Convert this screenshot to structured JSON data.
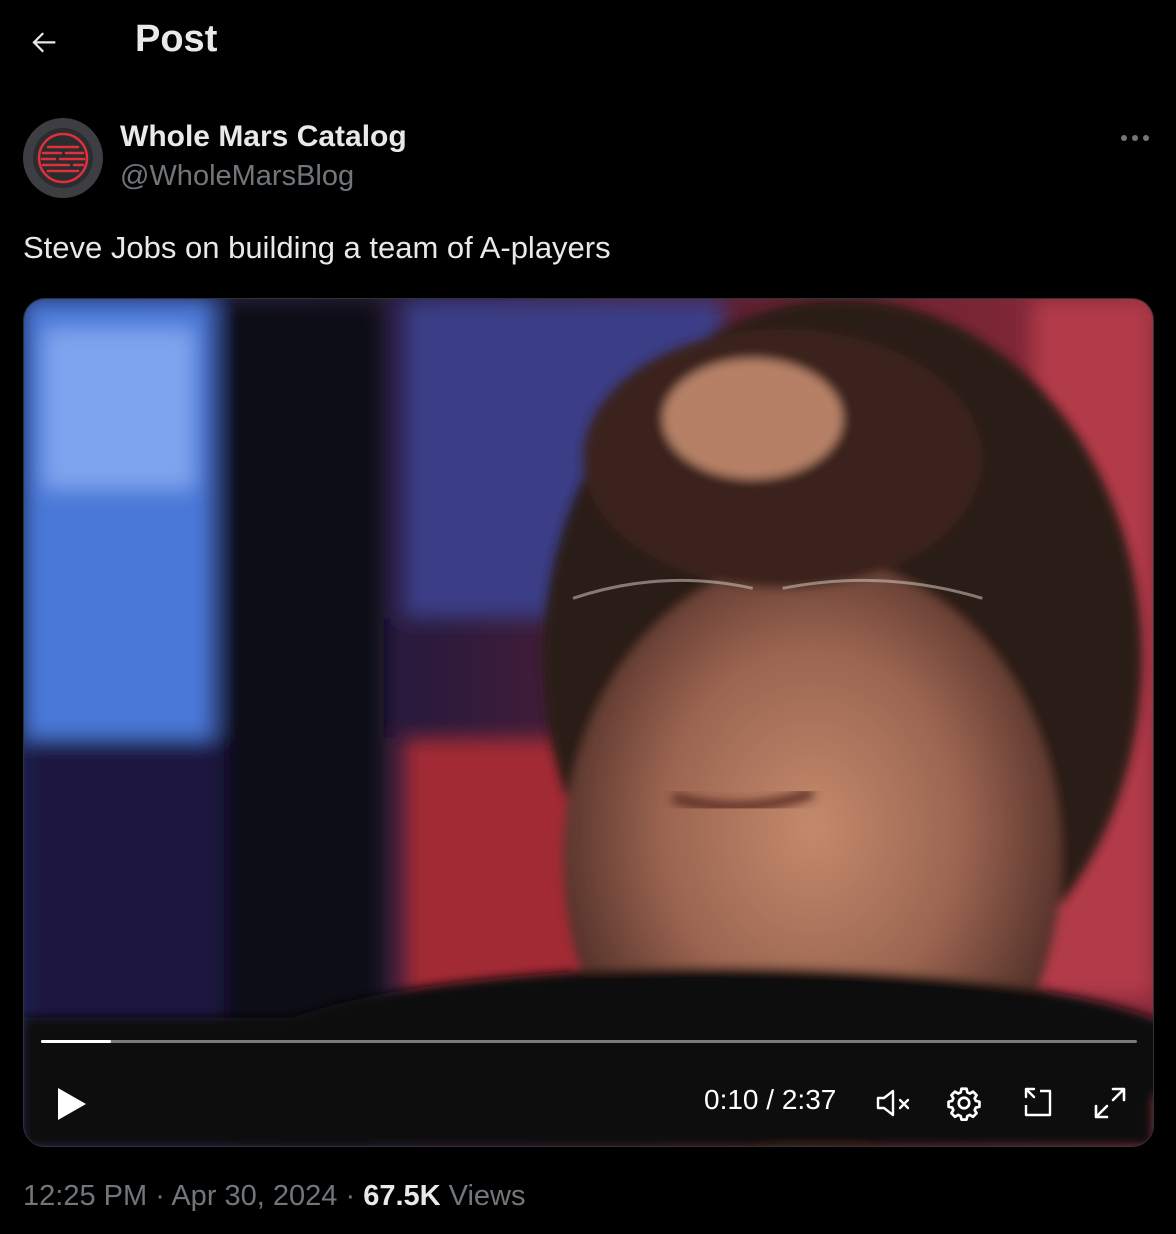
{
  "header": {
    "title": "Post",
    "back_icon": "arrow-left-icon"
  },
  "author": {
    "name": "Whole Mars Catalog",
    "handle": "@WholeMarsBlog",
    "avatar_icon": "mars-logo-icon",
    "more_icon": "ellipsis-icon"
  },
  "tweet": {
    "text": "Steve Jobs on building a team of A-players"
  },
  "video": {
    "current_time": "0:10",
    "separator": "/",
    "duration": "2:37",
    "progress": 0.064,
    "icons": [
      "play-icon",
      "mute-icon",
      "settings-icon",
      "picture-in-picture-icon",
      "fullscreen-icon"
    ]
  },
  "meta": {
    "time": "12:25 PM",
    "date": "Apr 30, 2024",
    "views_count": "67.5K",
    "views_label": "Views",
    "dot": "·"
  },
  "colors": {
    "background": "#000000",
    "text": "#e7e9ea",
    "secondary": "#71767b",
    "logo_red": "#e0303a"
  }
}
